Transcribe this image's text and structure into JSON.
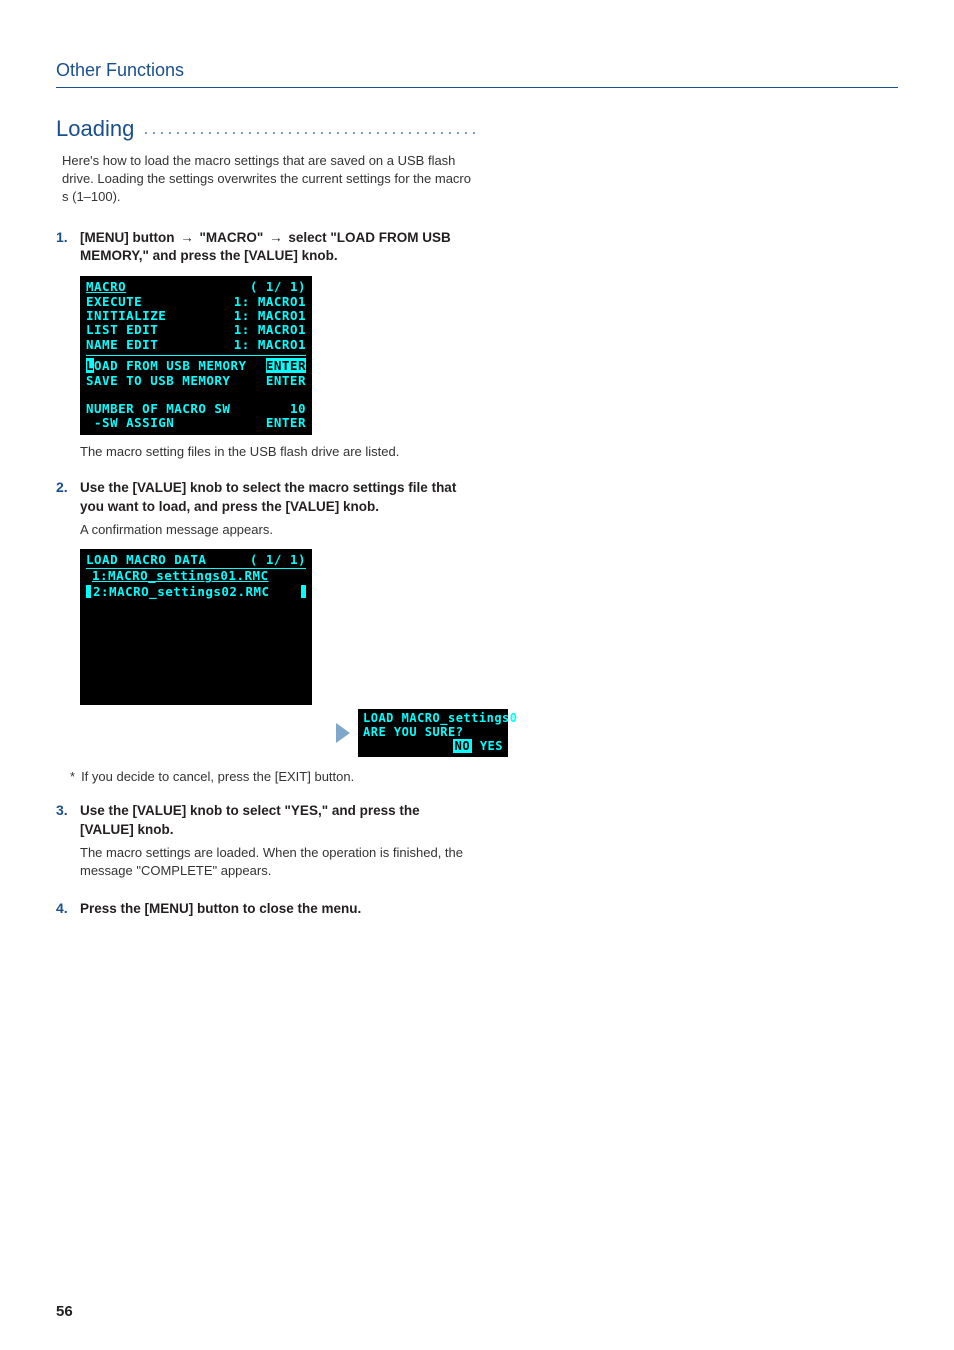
{
  "header": {
    "section": "Other Functions"
  },
  "title": "Loading",
  "intro": "Here's how to load the macro settings that are saved on a USB flash drive. Loading the settings overwrites the current settings for the macro​s (1–100).",
  "steps": {
    "s1": {
      "num": "1.",
      "t1": "[MENU] button",
      "arrow": "→",
      "t2": "\"MACRO\"",
      "t3": "select \"LOAD FROM USB MEMORY,\" and press the [VALUE] knob.",
      "after": "The macro setting files in the USB flash drive are listed."
    },
    "s2": {
      "num": "2.",
      "text": "Use the [VALUE] knob to select the macro settings file that you want to load, and press the [VALUE] knob.",
      "after": "A confirmation message appears."
    },
    "s3": {
      "num": "3.",
      "text": "Use the [VALUE] knob to select \"YES,\" and press the [VALUE] knob.",
      "after": "The macro settings are loaded. When the operation is finished, the message \"COMPLETE\" appears."
    },
    "s4": {
      "num": "4.",
      "text": "Press the [MENU] button to close the menu."
    }
  },
  "note": "If you decide to cancel, press the [EXIT] button.",
  "lcd1": {
    "title_l": "MACRO",
    "title_r": "( 1/ 1)",
    "rows": [
      {
        "l": "EXECUTE",
        "r": "1: MACRO1"
      },
      {
        "l": "INITIALIZE",
        "r": "1: MACRO1"
      },
      {
        "l": "LIST EDIT",
        "r": "1: MACRO1"
      },
      {
        "l": "NAME EDIT",
        "r": "1: MACRO1"
      }
    ],
    "sel": {
      "l": "LOAD FROM USB MEMORY",
      "r": "ENTER"
    },
    "after_sel": {
      "l": "SAVE TO USB MEMORY",
      "r": "ENTER"
    },
    "rows2": [
      {
        "l": "NUMBER OF MACRO SW",
        "r": "10"
      },
      {
        "l": " -SW ASSIGN",
        "r": "ENTER"
      }
    ]
  },
  "lcd2": {
    "title_l": "LOAD MACRO DATA",
    "title_r": "( 1/ 1)",
    "file1": "1:MACRO_settings01.RMC",
    "file2": "2:MACRO_settings02.RMC"
  },
  "dialog": {
    "line1": "LOAD MACRO_settings0",
    "line2": "ARE YOU SURE?",
    "no": "NO",
    "yes": "YES"
  },
  "page_number": "56"
}
